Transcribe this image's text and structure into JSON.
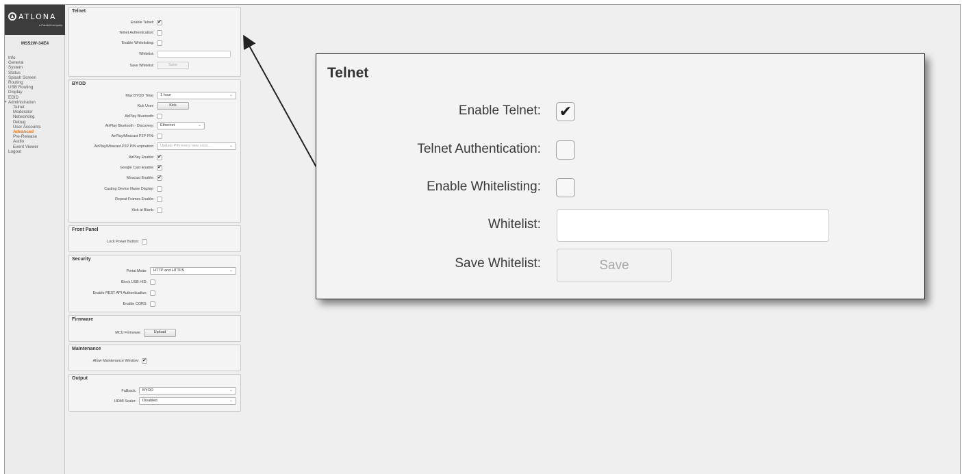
{
  "sidebar": {
    "brand": "ATLONA",
    "brand_sub": "a Panduit company",
    "model": "MS52W-34E4",
    "items": [
      {
        "label": "Info",
        "level": 0,
        "active": false
      },
      {
        "label": "General",
        "level": 0,
        "active": false
      },
      {
        "label": "System",
        "level": 0,
        "active": false
      },
      {
        "label": "Status",
        "level": 0,
        "active": false
      },
      {
        "label": "Splash Screen",
        "level": 0,
        "active": false
      },
      {
        "label": "Routing",
        "level": 0,
        "active": false
      },
      {
        "label": "USB Routing",
        "level": 0,
        "active": false
      },
      {
        "label": "Display",
        "level": 0,
        "active": false
      },
      {
        "label": "EDID",
        "level": 0,
        "active": false
      },
      {
        "label": "Administration",
        "level": 0,
        "active": false
      },
      {
        "label": "Telnet",
        "level": 1,
        "active": false
      },
      {
        "label": "Moderator",
        "level": 1,
        "active": false
      },
      {
        "label": "Networking",
        "level": 1,
        "active": false
      },
      {
        "label": "Debug",
        "level": 1,
        "active": false
      },
      {
        "label": "User Accounts",
        "level": 1,
        "active": false
      },
      {
        "label": "Advanced",
        "level": 1,
        "active": true
      },
      {
        "label": "Pre-Release",
        "level": 1,
        "active": false
      },
      {
        "label": "Audio",
        "level": 1,
        "active": false
      },
      {
        "label": "Event Viewer",
        "level": 1,
        "active": false
      },
      {
        "label": "Logout",
        "level": 0,
        "active": false
      }
    ]
  },
  "panels": {
    "telnet": {
      "title": "Telnet",
      "enable_telnet": {
        "label": "Enable Telnet:",
        "checked": true
      },
      "telnet_auth": {
        "label": "Telnet Authentication:",
        "checked": false
      },
      "enable_whitelisting": {
        "label": "Enable Whitelisting:",
        "checked": false
      },
      "whitelist": {
        "label": "Whitelist:",
        "value": ""
      },
      "save_whitelist": {
        "label": "Save Whitelist:",
        "button": "Save"
      }
    },
    "byod": {
      "title": "BYOD",
      "max_byod_time": {
        "label": "Max BYOD Time:",
        "value": "1 hour"
      },
      "kick_user": {
        "label": "Kick User:",
        "button": "Kick"
      },
      "airplay_bluetooth": {
        "label": "AirPlay Bluetooth:",
        "checked": false
      },
      "airplay_bt_discovery": {
        "label": "AirPlay Bluetooth - Discovery:",
        "value": "Ethernet"
      },
      "p2p_pin": {
        "label": "AirPlay/Miracast P2P PIN:",
        "checked": false
      },
      "p2p_pin_exp": {
        "label": "AirPlay/Miracast P2P PIN expiration:",
        "value": "Update PIN every new conn..."
      },
      "airplay_enable": {
        "label": "AirPlay Enable:",
        "checked": true
      },
      "google_cast": {
        "label": "Google Cast Enable:",
        "checked": true
      },
      "miracast": {
        "label": "Miracast Enable:",
        "checked": true
      },
      "casting_name": {
        "label": "Casting Device Name Display:",
        "checked": false
      },
      "repeat_frames": {
        "label": "Repeat Frames Enable:",
        "checked": false
      },
      "kick_at_blank": {
        "label": "Kick at Blank:",
        "checked": false
      }
    },
    "front_panel": {
      "title": "Front Panel",
      "lock_power": {
        "label": "Lock Power Button:",
        "checked": false
      }
    },
    "security": {
      "title": "Security",
      "portal_mode": {
        "label": "Portal Mode:",
        "value": "HTTP and HTTPS"
      },
      "block_usb_hid": {
        "label": "Block USB HID:",
        "checked": false
      },
      "rest_api_auth": {
        "label": "Enable REST API Authentication:",
        "checked": false
      },
      "cors": {
        "label": "Enable CORS:",
        "checked": false
      }
    },
    "firmware": {
      "title": "Firmware",
      "mcu": {
        "label": "MCU Firmware:",
        "button": "Upload"
      }
    },
    "maintenance": {
      "title": "Maintenance",
      "window": {
        "label": "Allow Maintenance Window:",
        "checked": true
      }
    },
    "output": {
      "title": "Output",
      "fallback": {
        "label": "Fallback:",
        "value": "BYOD"
      },
      "hdmi_scaler": {
        "label": "HDMI Scaler:",
        "value": "Disabled"
      }
    }
  },
  "zoom": {
    "title": "Telnet",
    "enable_telnet": {
      "label": "Enable Telnet:",
      "checked": true
    },
    "telnet_auth": {
      "label": "Telnet Authentication:",
      "checked": false
    },
    "enable_whitelisting": {
      "label": "Enable Whitelisting:",
      "checked": false
    },
    "whitelist": {
      "label": "Whitelist:",
      "value": ""
    },
    "save_whitelist": {
      "label": "Save Whitelist:",
      "button": "Save"
    }
  },
  "icons": {
    "checkmark": "checkmark-icon",
    "dropdown": "chevron-down-icon",
    "logo": "atlona-logo-icon"
  },
  "colors": {
    "active_nav": "#e3731b",
    "logo_bg": "#3c3c3c"
  }
}
